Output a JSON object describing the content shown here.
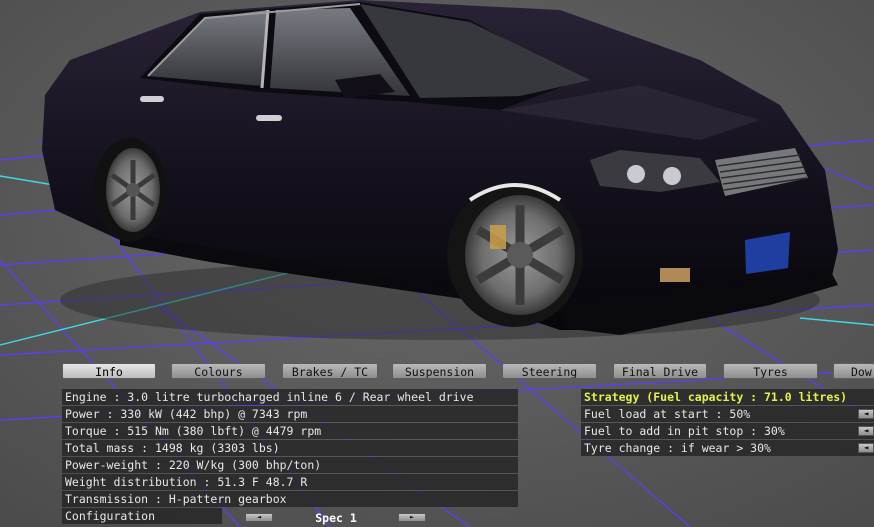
{
  "tabs": [
    {
      "label": "Info",
      "active": true
    },
    {
      "label": "Colours",
      "active": false
    },
    {
      "label": "Brakes / TC",
      "active": false
    },
    {
      "label": "Suspension",
      "active": false
    },
    {
      "label": "Steering",
      "active": false
    },
    {
      "label": "Final Drive",
      "active": false
    },
    {
      "label": "Tyres",
      "active": false
    },
    {
      "label": "Dow",
      "active": false
    }
  ],
  "info": {
    "engine": "Engine : 3.0 litre turbocharged inline 6 / Rear wheel drive",
    "power": "Power : 330 kW (442 bhp) @ 7343 rpm",
    "torque": "Torque : 515 Nm (380 lbft) @ 4479 rpm",
    "mass": "Total mass : 1498 kg (3303 lbs)",
    "power_weight": "Power-weight : 220 W/kg (300 bhp/ton)",
    "weight_distribution": "Weight distribution : 51.3 F  48.7 R",
    "transmission": "Transmission : H-pattern gearbox",
    "configuration_label": "Configuration",
    "configuration_value": "Spec 1"
  },
  "strategy": {
    "title": "Strategy (Fuel capacity : 71.0 litres)",
    "fuel_load": "Fuel load at start : 50%",
    "fuel_add": "Fuel to add in pit stop : 30%",
    "tyre_change": "Tyre change : if wear > 30%"
  },
  "icons": {
    "left_arrow": "◄",
    "right_arrow": "►"
  },
  "colors": {
    "car_body": "#15101c",
    "grid_line": "#5a3ff0",
    "accent_line": "#3fd8e0",
    "strategy_title": "#e6f04a"
  }
}
